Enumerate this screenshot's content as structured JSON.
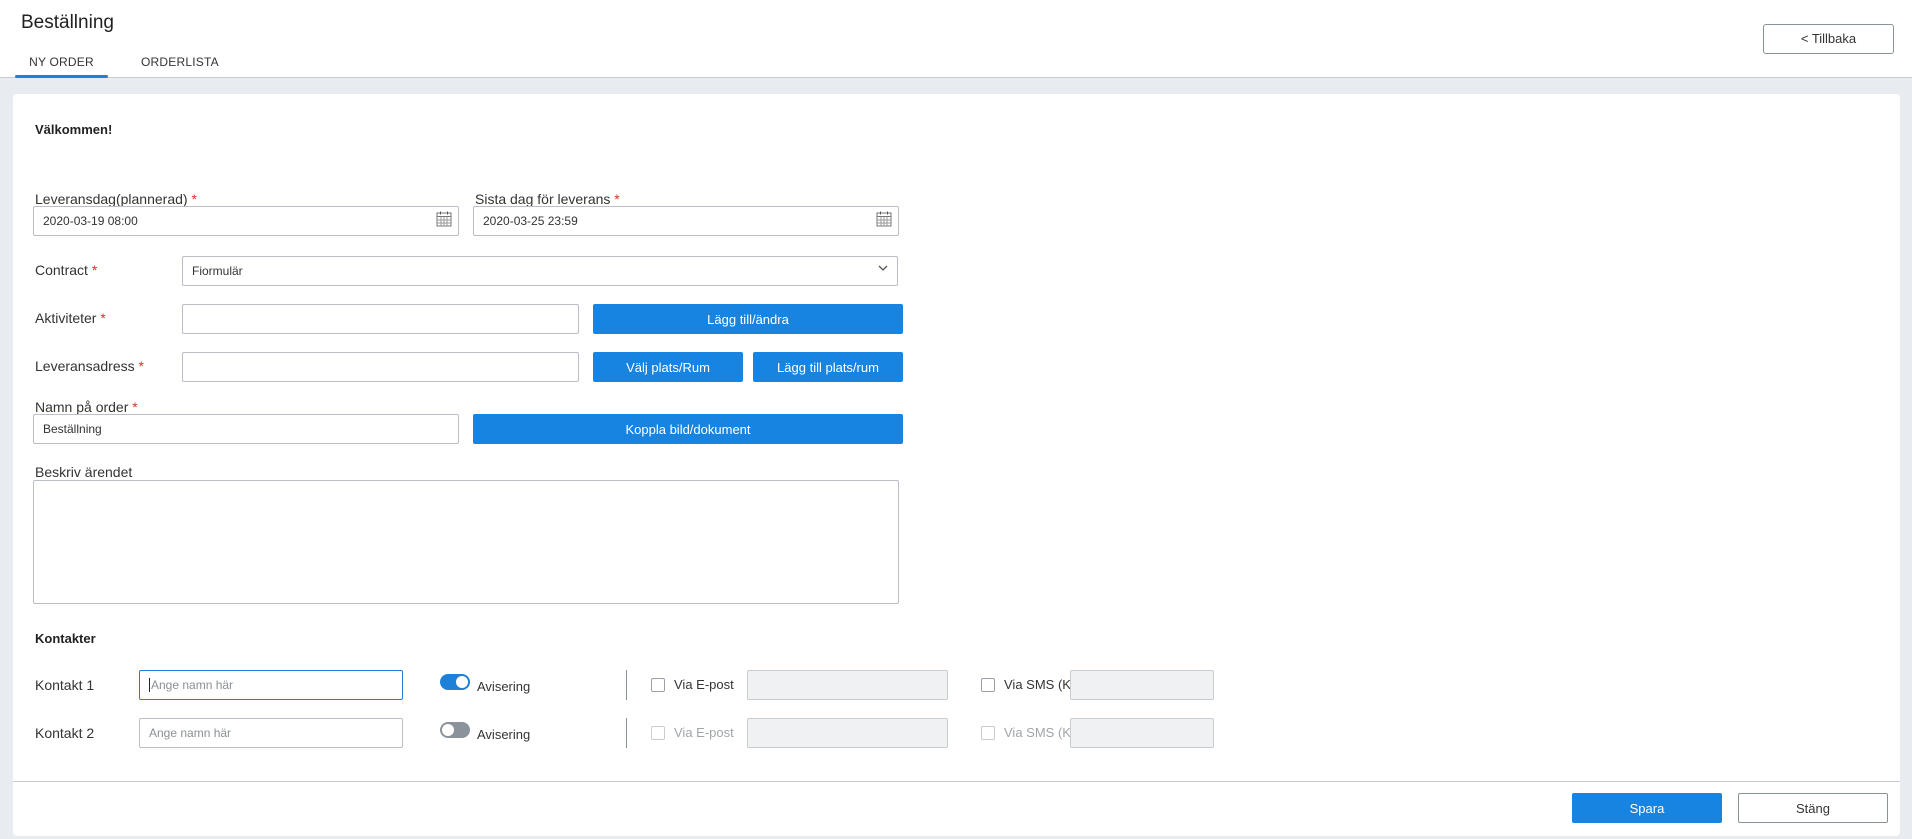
{
  "header": {
    "title": "Beställning",
    "tabs": [
      {
        "label": "NY ORDER",
        "active": true
      },
      {
        "label": "ORDERLISTA",
        "active": false
      }
    ],
    "back_label": "< Tillbaka"
  },
  "form": {
    "welcome": "Välkommen!",
    "planned_delivery": {
      "label": "Leveransdag(plannerad)",
      "required": "*",
      "value": "2020-03-19 08:00",
      "icon": "calendar-icon"
    },
    "last_delivery": {
      "label": "Sista dag för leverans",
      "required": "*",
      "value": "2020-03-25 23:59",
      "icon": "calendar-icon"
    },
    "contract": {
      "label": "Contract",
      "required": "*",
      "value": "Fiormulär",
      "icon": "chevron-down-icon"
    },
    "activities": {
      "label": "Aktiviteter",
      "required": "*",
      "value": "",
      "button": "Lägg till/ändra"
    },
    "delivery_address": {
      "label": "Leveransadress",
      "required": "*",
      "value": "",
      "button_select": "Välj plats/Rum",
      "button_add": "Lägg till plats/rum"
    },
    "order_name": {
      "label": "Namn på order",
      "required": "*",
      "value": "Beställning",
      "button": "Koppla bild/dokument"
    },
    "description": {
      "label": "Beskriv ärendet",
      "value": ""
    }
  },
  "contacts": {
    "title": "Kontakter",
    "rows": [
      {
        "label": "Kontakt 1",
        "placeholder": "Ange namn här",
        "toggle_label": "Avisering",
        "toggle_on": true,
        "email_label": "Via E-post",
        "sms_label": "Via SMS (K"
      },
      {
        "label": "Kontakt 2",
        "placeholder": "Ange namn här",
        "toggle_label": "Avisering",
        "toggle_on": false,
        "email_label": "Via E-post",
        "sms_label": "Via SMS (K"
      }
    ]
  },
  "footer": {
    "save_label": "Spara",
    "close_label": "Stäng"
  },
  "colors": {
    "accent": "#1784e2",
    "required": "#d93025"
  }
}
